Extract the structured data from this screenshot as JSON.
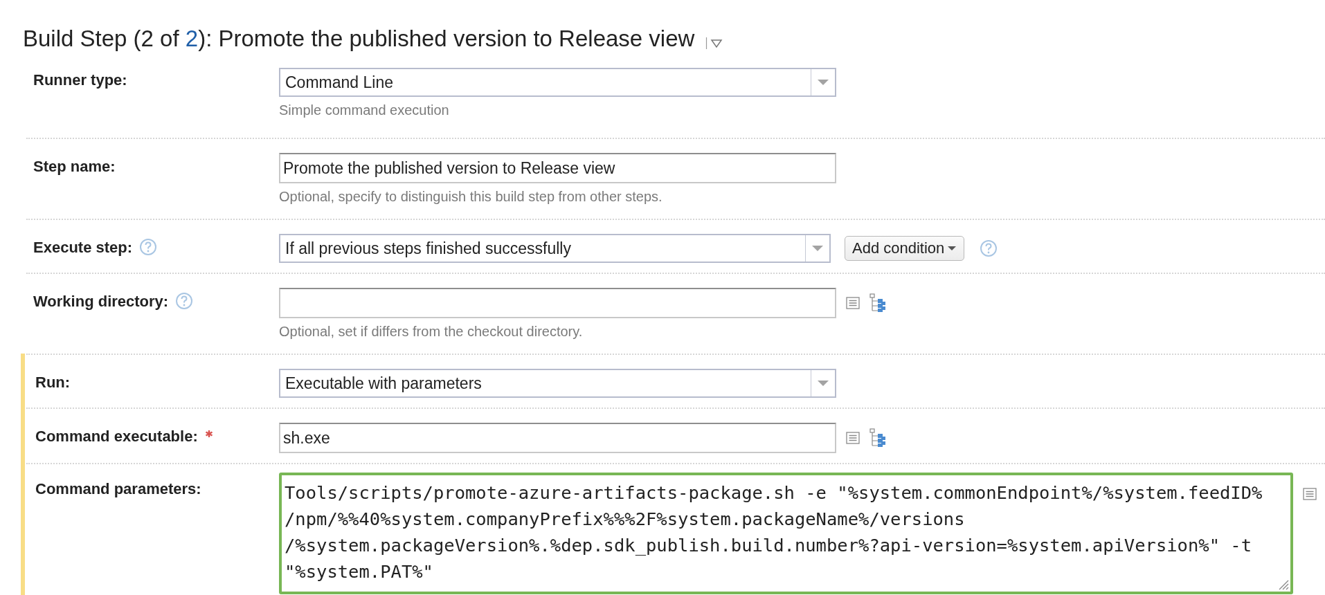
{
  "title": {
    "before": "Build Step (2 of ",
    "link": "2",
    "after": "): Promote the published version to Release view"
  },
  "sections": [
    {
      "highlighted": false,
      "rows": [
        {
          "kind": "select",
          "label": "Runner type:",
          "required": false,
          "help": false,
          "text": "Command Line",
          "hint": "Simple command execution"
        },
        {
          "kind": "input",
          "label": "Step name:",
          "required": false,
          "help": false,
          "text": "Promote the published version to Release view",
          "hint": "Optional, specify to distinguish this build step from other steps."
        },
        {
          "kind": "select",
          "label": "Execute step:",
          "required": false,
          "help": true,
          "text": "If all previous steps finished successfully",
          "button": "Add condition"
        },
        {
          "kind": "input",
          "label": "Working directory:",
          "required": false,
          "help": true,
          "text": "",
          "tools": true,
          "hint": "Optional, set if differs from the checkout directory."
        }
      ]
    },
    {
      "highlighted": true,
      "rows": [
        {
          "kind": "select",
          "label": "Run:",
          "required": false,
          "help": false,
          "text": "Executable with parameters"
        },
        {
          "kind": "input",
          "label": "Command executable:",
          "required": true,
          "help": false,
          "text": "sh.exe",
          "tools": true
        },
        {
          "kind": "textarea",
          "label": "Command parameters:",
          "required": false,
          "help": false,
          "focused": true,
          "lines": [
            "Tools/scripts/promote-azure-artifacts-package.sh -e \"%system.commonEndpoint%/%system.feedID%",
            "/npm/%%40%system.companyPrefix%%%2F%system.packageName%/versions",
            "/%system.packageVersion%.%dep.sdk_publish.build.number%?api-version=%system.apiVersion%\" -t",
            "\"%system.PAT%\""
          ]
        }
      ]
    }
  ]
}
